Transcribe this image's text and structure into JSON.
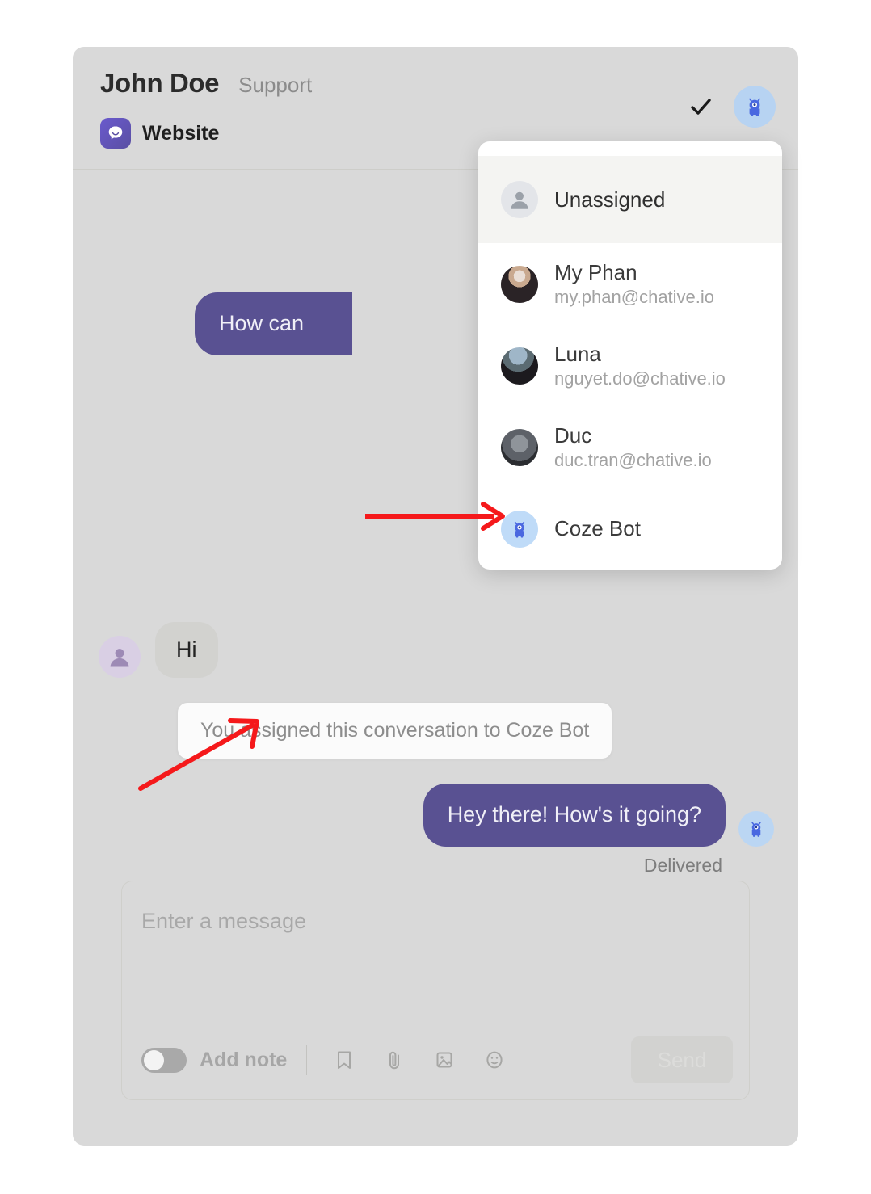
{
  "header": {
    "customer_name": "John Doe",
    "department": "Support",
    "channel_label": "Website",
    "channel_icon": "chat-bubble-icon",
    "resolve_icon": "check-icon",
    "assignee_avatar_icon": "coze-bot-avatar-icon"
  },
  "assignee_dropdown": {
    "items": [
      {
        "name": "Unassigned",
        "email": "",
        "avatar": "person-placeholder-icon",
        "selected": true
      },
      {
        "name": "My Phan",
        "email": "my.phan@chative.io",
        "avatar": "user-photo-avatar",
        "selected": false
      },
      {
        "name": "Luna",
        "email": "nguyet.do@chative.io",
        "avatar": "user-photo-avatar",
        "selected": false
      },
      {
        "name": "Duc",
        "email": "duc.tran@chative.io",
        "avatar": "user-photo-avatar",
        "selected": false
      },
      {
        "name": "Coze Bot",
        "email": "",
        "avatar": "coze-bot-avatar-icon",
        "selected": false
      }
    ]
  },
  "conversation": {
    "messages": [
      {
        "id": "m1",
        "direction": "outgoing",
        "text": "How can",
        "truncated": true
      },
      {
        "id": "m2",
        "direction": "incoming",
        "text": "Hi",
        "avatar": "visitor-avatar-icon"
      },
      {
        "id": "m3",
        "direction": "system",
        "text": "You assigned this conversation to Coze Bot"
      },
      {
        "id": "m4",
        "direction": "outgoing",
        "text": "Hey there! How's it going?",
        "avatar": "coze-bot-avatar-icon",
        "status": "Delivered"
      }
    ],
    "delivered_label": "Delivered"
  },
  "composer": {
    "placeholder": "Enter a message",
    "add_note_label": "Add note",
    "add_note_enabled": false,
    "send_label": "Send",
    "send_enabled": false,
    "tools": [
      {
        "name": "saved-reply-icon",
        "label": "Saved reply"
      },
      {
        "name": "attachment-icon",
        "label": "Attach file"
      },
      {
        "name": "image-icon",
        "label": "Insert image"
      },
      {
        "name": "emoji-icon",
        "label": "Emoji"
      }
    ]
  },
  "annotations": {
    "arrow_color": "#f5191b",
    "arrows": [
      {
        "name": "arrow-to-coze-bot-option",
        "direction": "right"
      },
      {
        "name": "arrow-to-assignment-note",
        "direction": "up-right"
      }
    ]
  },
  "colors": {
    "page_background": "#ffffff",
    "panel_background": "#d9d9d9",
    "outgoing_bubble": "#595192",
    "incoming_bubble": "#d2d2cf",
    "system_note_background": "#fbfbfb",
    "brand_purple": "#6a5acd",
    "bot_accent": "#4a68e0",
    "bot_avatar_background": "#bbd6f3",
    "annotation_red": "#f5191b"
  }
}
